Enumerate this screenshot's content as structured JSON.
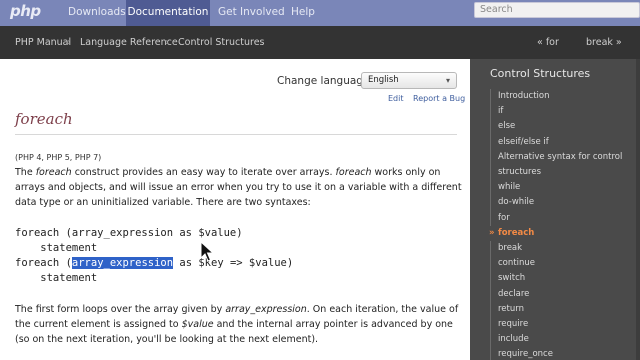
{
  "nav": {
    "logo": "php",
    "items": [
      "Downloads",
      "Documentation",
      "Get Involved",
      "Help"
    ],
    "search_placeholder": "Search"
  },
  "breadcrumb": {
    "items": [
      "PHP Manual",
      "Language Reference",
      "Control Structures"
    ],
    "separator": "›",
    "prev": "« for",
    "next": "break »"
  },
  "main": {
    "change_language_label": "Change language:",
    "language_value": "English",
    "edit": "Edit",
    "report_bug": "Report a Bug",
    "title": "foreach",
    "versions": "(PHP 4, PHP 5, PHP 7)",
    "para1_a": "The ",
    "para1_em1": "foreach",
    "para1_b": " construct provides an easy way to iterate over arrays. ",
    "para1_em2": "foreach",
    "para1_c": " works only on arrays and objects, and will issue an error when you try to use it on a variable with a different data type or an uninitialized variable. There are two syntaxes:",
    "code": {
      "line1": "foreach (array_expression as $value)",
      "line2": "    statement",
      "line3_a": "foreach (",
      "line3_sel": "array_expression",
      "line3_b": " as $key => $value)",
      "line4": "    statement"
    },
    "para2_a": "The first form loops over the array given by ",
    "para2_em1": "array_expression",
    "para2_b": ". On each iteration, the value of the current element is assigned to ",
    "para2_em2": "$value",
    "para2_c": " and the internal array pointer is advanced by one (so on the next iteration, you'll be looking at the next element)."
  },
  "sidebar": {
    "title": "Control Structures",
    "active_marker": "»",
    "items": [
      "Introduction",
      "if",
      "else",
      "elseif/else if",
      "Alternative syntax for control structures",
      "while",
      "do-while",
      "for",
      "foreach",
      "break",
      "continue",
      "switch",
      "declare",
      "return",
      "require",
      "include",
      "require_once"
    ],
    "active_index": 8
  },
  "colors": {
    "nav_bg": "#7a86b8",
    "nav_active": "#4f5b93",
    "crumb_bg": "#333333",
    "sidebar_bg": "#4a4a4a",
    "title_color": "#7d3f4a",
    "active_item": "#f38a45",
    "selection": "#2f62c8"
  },
  "icons": [
    "mouse-pointer-icon",
    "chevron-down-icon"
  ]
}
